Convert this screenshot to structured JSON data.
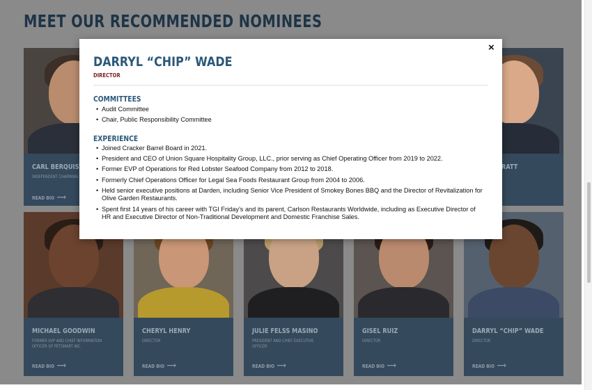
{
  "page": {
    "title": "MEET OUR RECOMMENDED NOMINEES"
  },
  "colors": {
    "accent": "#2c5878",
    "role_accent": "#7a1f1f",
    "card_bg": "#35495a",
    "overlay": "#8a8a8a"
  },
  "cards_top": [
    {
      "name": "CARL BERQUIST",
      "role": "INDEPENDENT CHAIRMAN",
      "read": "READ BIO"
    },
    {
      "name": "",
      "role": "",
      "read": ""
    },
    {
      "name": "",
      "role": "",
      "read": ""
    },
    {
      "name": "",
      "role": "",
      "read": ""
    },
    {
      "name": "RATT",
      "role": "",
      "read": ""
    }
  ],
  "cards_bottom": [
    {
      "name": "MICHAEL GOODWIN",
      "role": "FORMER SVP AND CHIEF INFORMATION OFFICER OF PETSMART INC.",
      "read": "READ BIO"
    },
    {
      "name": "CHERYL HENRY",
      "role": "DIRECTOR",
      "read": "READ BIO"
    },
    {
      "name": "JULIE FELSS MASINO",
      "role": "PRESIDENT AND CHIEF EXECUTIVE OFFICER",
      "read": "READ BIO"
    },
    {
      "name": "GISEL RUIZ",
      "role": "DIRECTOR",
      "read": "READ BIO"
    },
    {
      "name": "DARRYL “CHIP” WADE",
      "role": "DIRECTOR",
      "read": "READ BIO"
    }
  ],
  "modal": {
    "close": "×",
    "name": "DARRYL “CHIP” WADE",
    "role": "DIRECTOR",
    "committees_heading": "COMMITTEES",
    "committees": [
      "Audit Committee",
      "Chair, Public Responsibility Committee"
    ],
    "experience_heading": "EXPERIENCE",
    "experience": [
      "Joined Cracker Barrel Board in 2021.",
      "President and CEO of Union Square Hospitality Group, LLC., prior serving as Chief Operating Officer from 2019 to 2022.",
      "Former EVP of Operations for Red Lobster Seafood Company from 2012 to 2018.",
      "Formerly Chief Operations Officer for Legal Sea Foods Restaurant Group from 2004 to 2006.",
      "Held senior executive positions at Darden, including Senior Vice President of Smokey Bones BBQ and the Director of Revitalization for Olive Garden Restaurants.",
      "Spent first 14 years of his career with TGI Friday’s and its parent, Carlson Restaurants Worldwide, including as Executive Director of HR and Executive Director of Non-Traditional Development and Domestic Franchise Sales."
    ]
  }
}
